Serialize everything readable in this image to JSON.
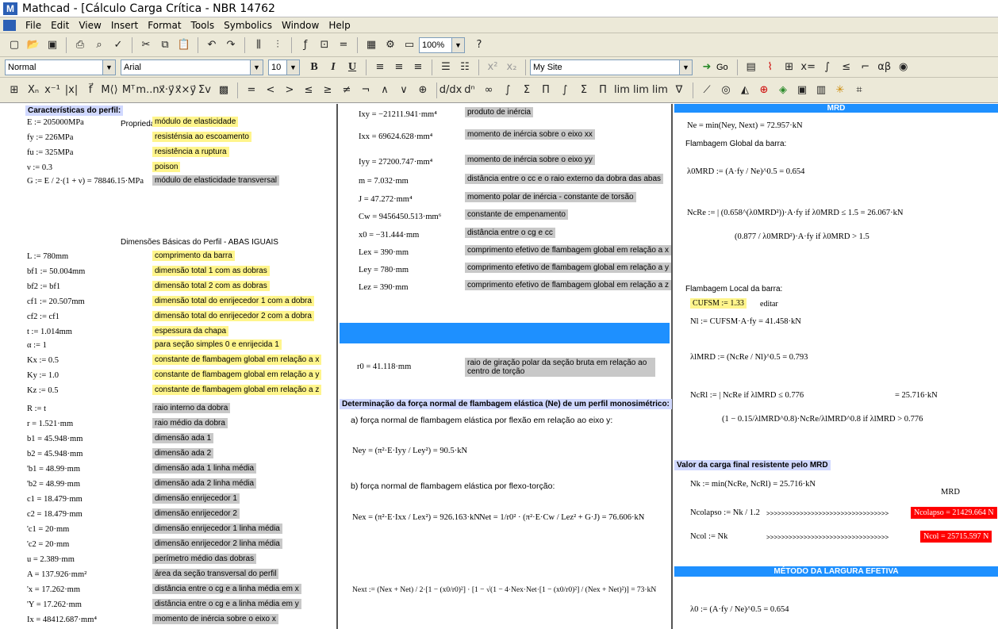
{
  "window": {
    "title": "Mathcad - [Cálculo Carga Crítica - NBR 14762"
  },
  "menu": [
    "File",
    "Edit",
    "View",
    "Insert",
    "Format",
    "Tools",
    "Symbolics",
    "Window",
    "Help"
  ],
  "toolbar1": {
    "zoom": "100%"
  },
  "toolbar2": {
    "style": "Normal",
    "font": "Arial",
    "size": "10",
    "site": "My Site",
    "go_label": "Go"
  },
  "col1": {
    "header": "Características do perfil:",
    "sub1": "Propriedades do Material",
    "sub2": "Dimensões Básicas do Perfil - ABAS IGUAIS",
    "rows": [
      {
        "m": "E := 205000MPa",
        "l": "módulo de elasticidade",
        "c": "yl"
      },
      {
        "m": "fy := 226MPa",
        "l": "resisténsia ao escoamento",
        "c": "yl"
      },
      {
        "m": "fu := 325MPa",
        "l": "resistência a ruptura",
        "c": "yl"
      },
      {
        "m": "ν := 0.3",
        "l": "poison",
        "c": "yl"
      },
      {
        "m": "G := E / 2·(1 + ν) = 78846.15·MPa",
        "l": "módulo de elasticidade transversal",
        "c": "gr"
      },
      {
        "m": "L := 780mm",
        "l": "comprimento da barra",
        "c": "yl"
      },
      {
        "m": "bf1 := 50.004mm",
        "l": "dimensão total 1 com as dobras",
        "c": "yl"
      },
      {
        "m": "bf2 := bf1",
        "l": "dimensão total 2 com as dobras",
        "c": "yl"
      },
      {
        "m": "cf1 := 20.507mm",
        "l": "dimensão total do enrijecedor 1 com a dobra",
        "c": "yl"
      },
      {
        "m": "cf2 := cf1",
        "l": "dimensão total do enrijecedor 2 com a dobra",
        "c": "yl"
      },
      {
        "m": "t := 1.014mm",
        "l": "espessura da chapa",
        "c": "yl"
      },
      {
        "m": "α := 1",
        "l": "para seção simples 0 e enrijecida 1",
        "c": "yl"
      },
      {
        "m": "Kx := 0.5",
        "l": "constante de flambagem global em relação a x",
        "c": "yl"
      },
      {
        "m": "Ky := 1.0",
        "l": "constante de flambagem global em relação a y",
        "c": "yl"
      },
      {
        "m": "Kz := 0.5",
        "l": "constante de flambagem global em relação a z",
        "c": "yl"
      },
      {
        "m": "R := t",
        "l": "raio interno da dobra",
        "c": "gr"
      },
      {
        "m": "r = 1.521·mm",
        "l": "raio médio da dobra",
        "c": "gr"
      },
      {
        "m": "b1 = 45.948·mm",
        "l": "dimensão ada 1",
        "c": "gr"
      },
      {
        "m": "b2 = 45.948·mm",
        "l": "dimensão ada 2",
        "c": "gr"
      },
      {
        "m": "'b1 = 48.99·mm",
        "l": "dimensão ada 1 linha média",
        "c": "gr"
      },
      {
        "m": "'b2 = 48.99·mm",
        "l": "dimensão ada 2 linha média",
        "c": "gr"
      },
      {
        "m": "c1 = 18.479·mm",
        "l": "dimensão enrijecedor 1",
        "c": "gr"
      },
      {
        "m": "c2 = 18.479·mm",
        "l": "dimensão enrijecedor 2",
        "c": "gr"
      },
      {
        "m": "'c1 = 20·mm",
        "l": "dimensão enrijecedor 1 linha média",
        "c": "gr"
      },
      {
        "m": "'c2 = 20·mm",
        "l": "dimensão enrijecedor 2 linha média",
        "c": "gr"
      },
      {
        "m": "u = 2.389·mm",
        "l": "perímetro médio das dobras",
        "c": "gr"
      },
      {
        "m": "A = 137.926·mm²",
        "l": "área da seção transversal do perfil",
        "c": "gr"
      },
      {
        "m": "'x = 17.262·mm",
        "l": "distância entre o cg e a linha média em x",
        "c": "gr"
      },
      {
        "m": "'Y = 17.262·mm",
        "l": "distância entre o cg e a linha média em y",
        "c": "gr"
      },
      {
        "m": "Ix = 48412.687·mm⁴",
        "l": "momento de inércia sobre o eixo x",
        "c": "gr"
      }
    ]
  },
  "col2": {
    "rows": [
      {
        "m": "Ixy = −21211.941·mm⁴",
        "l": "produto de inércia"
      },
      {
        "m": "Ixx = 69624.628·mm⁴",
        "l": "momento de inércia sobre o eixo xx"
      },
      {
        "m": "Iyy = 27200.747·mm⁴",
        "l": "momento de inércia sobre o eixo yy"
      },
      {
        "m": "m = 7.032·mm",
        "l": "distância entre o cc e o raio externo da dobra das abas"
      },
      {
        "m": "J = 47.272·mm⁴",
        "l": "momento polar de inércia - constante de torsão"
      },
      {
        "m": "Cw = 9456450.513·mm⁶",
        "l": "constante de empenamento"
      },
      {
        "m": "x0 = −31.444·mm",
        "l": "distância entre o cg e cc"
      },
      {
        "m": "Lex = 390·mm",
        "l": "comprimento efetivo de flambagem global em relação a x"
      },
      {
        "m": "Ley = 780·mm",
        "l": "comprimento efetivo de flambagem global em relação a y"
      },
      {
        "m": "Lez = 390·mm",
        "l": "comprimento efetivo de flambagem global em relação a z"
      }
    ],
    "r0": {
      "m": "r0 = 41.118·mm",
      "l": "raio de giração polar da seção bruta em relação ao centro de torção"
    },
    "sec_title": "Determinação da força normal de flambagem elástica (Ne) de um perfil monosimétrico:",
    "a_label": "a) força normal de flambagem elástica por flexão em relação ao eixo y:",
    "ney": "Ney = (π²·E·Iyy / Ley²) = 90.5·kN",
    "b_label": "b) força normal de flambagem elástica por flexo-torção:",
    "nex": "Nex = (π²·E·Ixx / Lex²) = 926.163·kN",
    "net": "Net = 1/r0² · (π²·E·Cw / Lez² + G·J) = 76.606·kN",
    "next": "Next := (Nex + Net) / 2·[1 − (x0/r0)²] · [1 − √(1 − 4·Nex·Net·[1 − (x0/r0)²] / (Nex + Net)²)] = 73·kN"
  },
  "col3": {
    "hdr_mrd": "MRD",
    "ne": "Ne = min(Ney, Next) = 72.957·kN",
    "fg": "Flambagem Global da barra:",
    "lam0": "λ0MRD := (A·fy / Ne)^0.5 = 0.654",
    "ncre1": "NcRe := | (0.658^(λ0MRD²))·A·fy  if λ0MRD ≤ 1.5   = 26.067·kN",
    "ncre2": "(0.877 / λ0MRD²)·A·fy  if λ0MRD > 1.5",
    "fl": "Flambagem Local da barra:",
    "cufsm": "CUFSM := 1.33",
    "editar": "editar",
    "nl": "Nl := CUFSM·A·fy = 41.458·kN",
    "laml": "λlMRD := (NcRe / Nl)^0.5 = 0.793",
    "ncrl1": "NcRl := | NcRe  if λlMRD ≤ 0.776",
    "ncrl_val": "= 25.716·kN",
    "ncrl2": "(1 − 0.15/λlMRD^0.8)·NcRe/λlMRD^0.8  if λlMRD > 0.776",
    "sec2": "Valor da carga final resistente pelo MRD",
    "nk": "Nk := min(NcRe, NcRl) = 25.716·kN",
    "mrd_label": "MRD",
    "ncolapso": "Ncolapso := Nk / 1.2",
    "arrows": ">>>>>>>>>>>>>>>>>>>>>>>>>>>>>>>>>",
    "ncolapso_val": "Ncolapso = 21429.664 N",
    "ncol": "Ncol := Nk",
    "ncol_val": "Ncol = 25715.597 N",
    "hdr_mle": "MÉTODO DA LARGURA EFETIVA",
    "lam0b": "λ0 := (A·fy / Ne)^0.5 = 0.654"
  }
}
